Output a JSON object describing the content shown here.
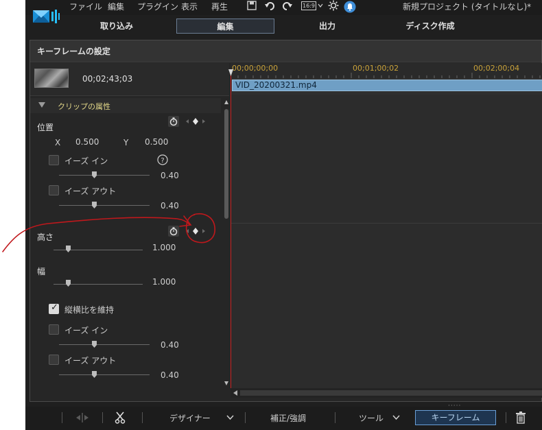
{
  "menu": {
    "items": [
      "ファイル",
      "編集",
      "プラグイン",
      "表示",
      "再生"
    ],
    "aspect_ratio": "16:9",
    "window_title": "新規プロジェクト (タイトルなし)*",
    "icons": [
      "save-icon",
      "undo-icon",
      "redo-icon",
      "aspect-ratio-icon",
      "settings-gear-icon",
      "notification-icon"
    ]
  },
  "tabs": [
    {
      "label": "取り込み"
    },
    {
      "label": "編集"
    },
    {
      "label": "出力"
    },
    {
      "label": "ディスク作成"
    }
  ],
  "panel": {
    "title": "キーフレームの設定",
    "clip_duration": "00;02;43;03",
    "attributes_label": "クリップの属性",
    "position": {
      "label": "位置",
      "x_label": "X",
      "x_value": "0.500",
      "y_label": "Y",
      "y_value": "0.500",
      "ease_in_label": "イーズ イン",
      "ease_in_value": "0.40",
      "ease_out_label": "イーズ アウト",
      "ease_out_value": "0.40"
    },
    "height": {
      "label": "高さ",
      "value": "1.000"
    },
    "width": {
      "label": "幅",
      "value": "1.000"
    },
    "aspect": {
      "label": "縦横比を維持",
      "checked": true,
      "ease_in_label": "イーズ イン",
      "ease_in_value": "0.40",
      "ease_out_label": "イーズ アウト",
      "ease_out_value": "0.40"
    }
  },
  "timeline": {
    "ticks": [
      "00;00;00;00",
      "00;01;00;02",
      "00;02;00;04"
    ],
    "clip_name": "VID_20200321.mp4"
  },
  "bottombar": {
    "designer_label": "デザイナー",
    "correction_label": "補正/強調",
    "tools_label": "ツール",
    "keyframe_label": "キーフレーム"
  },
  "colors": {
    "accent_blue": "#6aa0d8",
    "clip_blue": "#6f9fc5",
    "playhead_red": "#cc2222",
    "timecode_gold": "#c9a23a",
    "annotation_red": "#c0181c"
  }
}
